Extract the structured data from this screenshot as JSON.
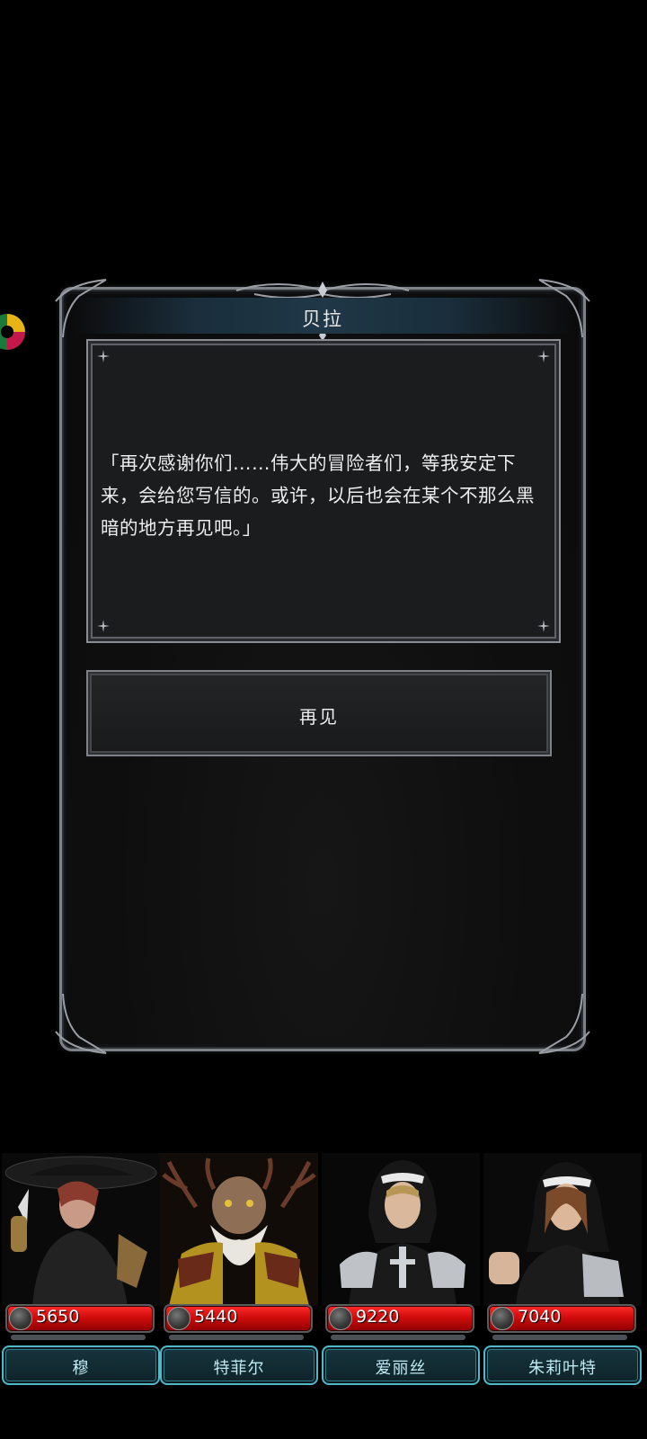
{
  "dialog": {
    "speaker": "贝拉",
    "message": "「再次感谢你们……伟大的冒险者们，等我安定下来，会给您写信的。或许，以后也会在某个不那么黑暗的地方再见吧。」",
    "option_label": "再见"
  },
  "party": [
    {
      "name": "穆",
      "hp": "5650",
      "portrait": "hooded-rogue"
    },
    {
      "name": "特菲尔",
      "hp": "5440",
      "portrait": "antlered-elder"
    },
    {
      "name": "爱丽丝",
      "hp": "9220",
      "portrait": "armored-nun"
    },
    {
      "name": "朱莉叶特",
      "hp": "7040",
      "portrait": "nun-fighter"
    }
  ],
  "colors": {
    "hp_bar": "#d10c0c",
    "name_plate_border": "#4fb7c8",
    "title_bar": "#1f3747"
  }
}
